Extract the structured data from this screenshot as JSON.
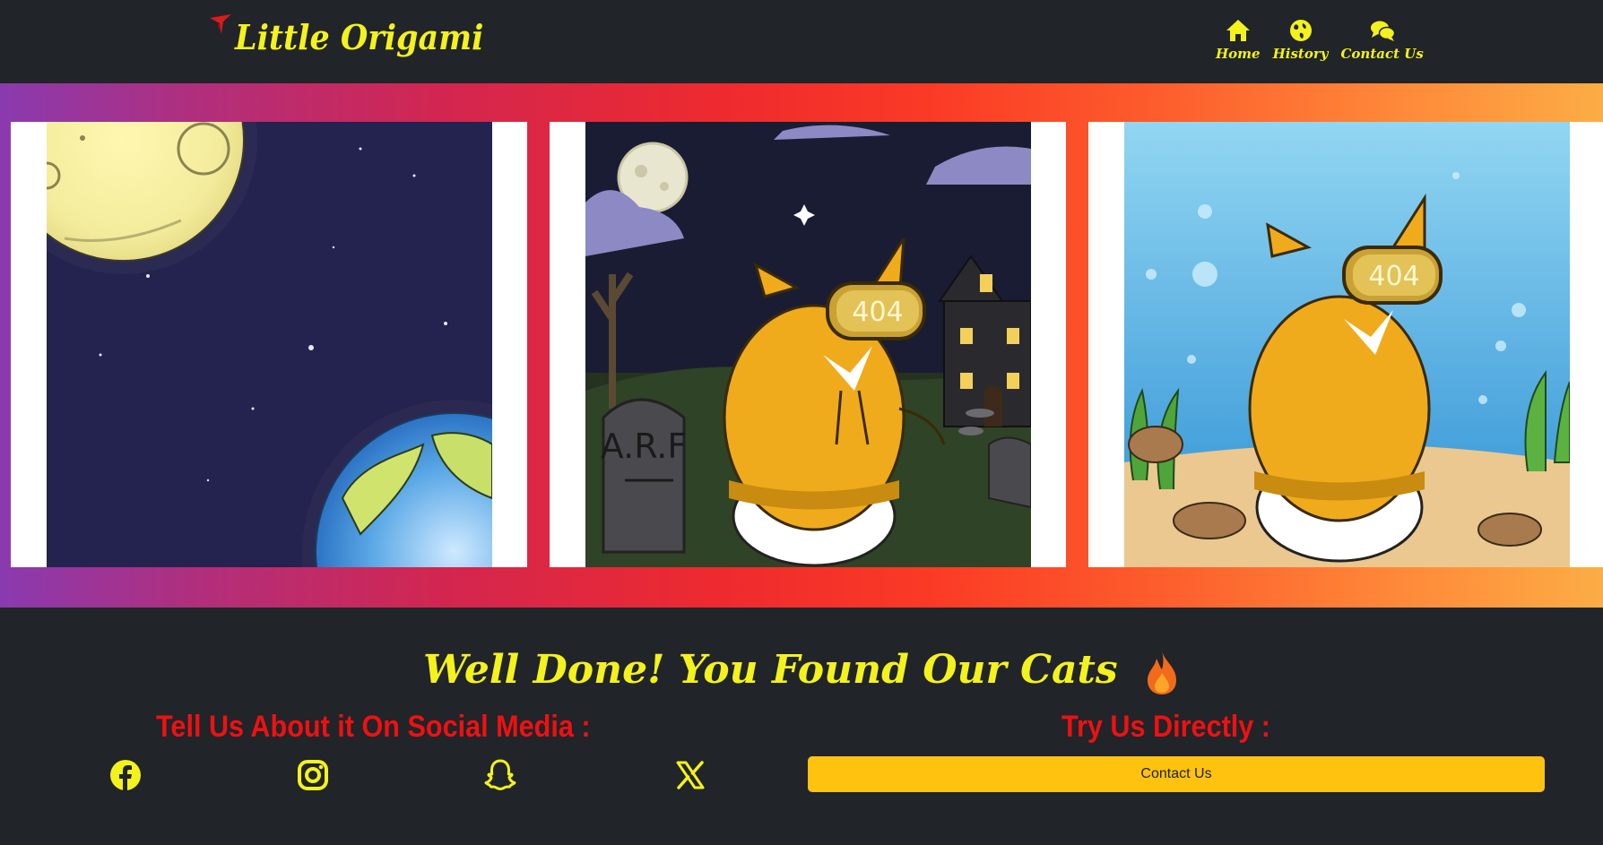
{
  "brand": {
    "title": "Little Origami",
    "logo_icon": "origami-crane-icon",
    "logo_color": "#d91c1c"
  },
  "nav": [
    {
      "label": "Home",
      "icon": "home-icon"
    },
    {
      "label": "History",
      "icon": "globe-icon"
    },
    {
      "label": "Contact Us",
      "icon": "chat-bubbles-icon"
    }
  ],
  "carousel": {
    "slides": [
      {
        "scene": "space",
        "moon": true,
        "planet": "earth"
      },
      {
        "scene": "graveyard",
        "tombstone_text": "A.R.F",
        "visor_text": "404"
      },
      {
        "scene": "underwater",
        "visor_text": "404"
      }
    ]
  },
  "main": {
    "headline": "Well Done! You Found Our Cats",
    "headline_icon": "fire-icon",
    "social_heading": "Tell Us About it On Social Media :",
    "direct_heading": "Try Us Directly :",
    "contact_button": "Contact Us",
    "social_icons": [
      "facebook-icon",
      "instagram-icon",
      "snapchat-icon",
      "x-icon"
    ]
  },
  "colors": {
    "accent": "#f3f21c",
    "heading_red": "#ee1111",
    "button": "#ffc20e",
    "background": "#212429"
  }
}
